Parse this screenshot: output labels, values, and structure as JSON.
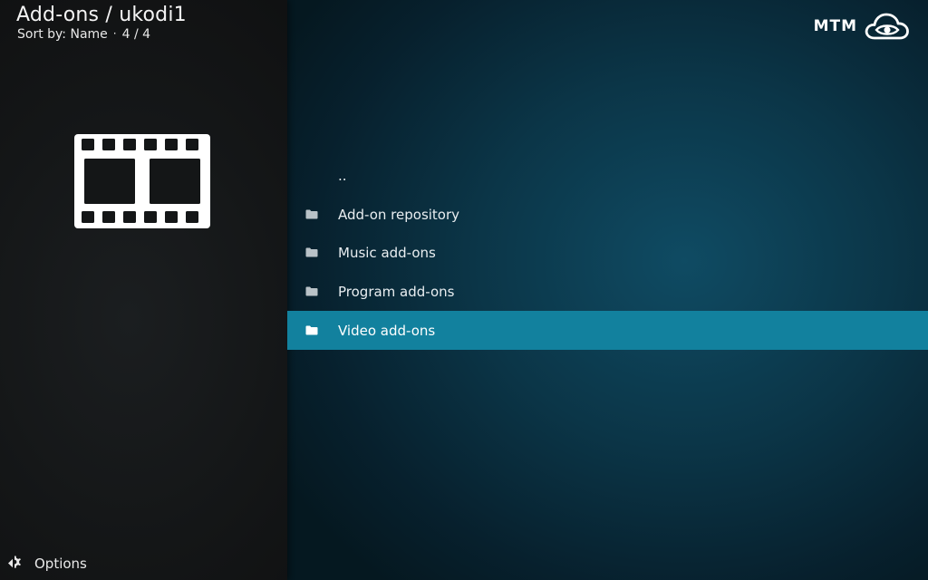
{
  "header": {
    "title": "Add-ons / ukodi1",
    "sort_label": "Sort by: Name",
    "separator": "·",
    "count": "4 / 4"
  },
  "logo": {
    "text": "MTM",
    "icon": "cloud-eye-icon"
  },
  "thumbnail": {
    "icon": "film-strip-icon"
  },
  "list": {
    "items": [
      {
        "label": "..",
        "icon": "none",
        "focused": false
      },
      {
        "label": "Add-on repository",
        "icon": "folder-icon",
        "focused": false
      },
      {
        "label": "Music add-ons",
        "icon": "folder-icon",
        "focused": false
      },
      {
        "label": "Program add-ons",
        "icon": "folder-icon",
        "focused": false
      },
      {
        "label": "Video add-ons",
        "icon": "folder-icon",
        "focused": true
      }
    ]
  },
  "footer": {
    "options_label": "Options",
    "options_icon": "gear-arrow-icon"
  },
  "colors": {
    "focus_bar": "#12819e",
    "left_panel": "#141617",
    "content_bg": "#0b3547"
  }
}
